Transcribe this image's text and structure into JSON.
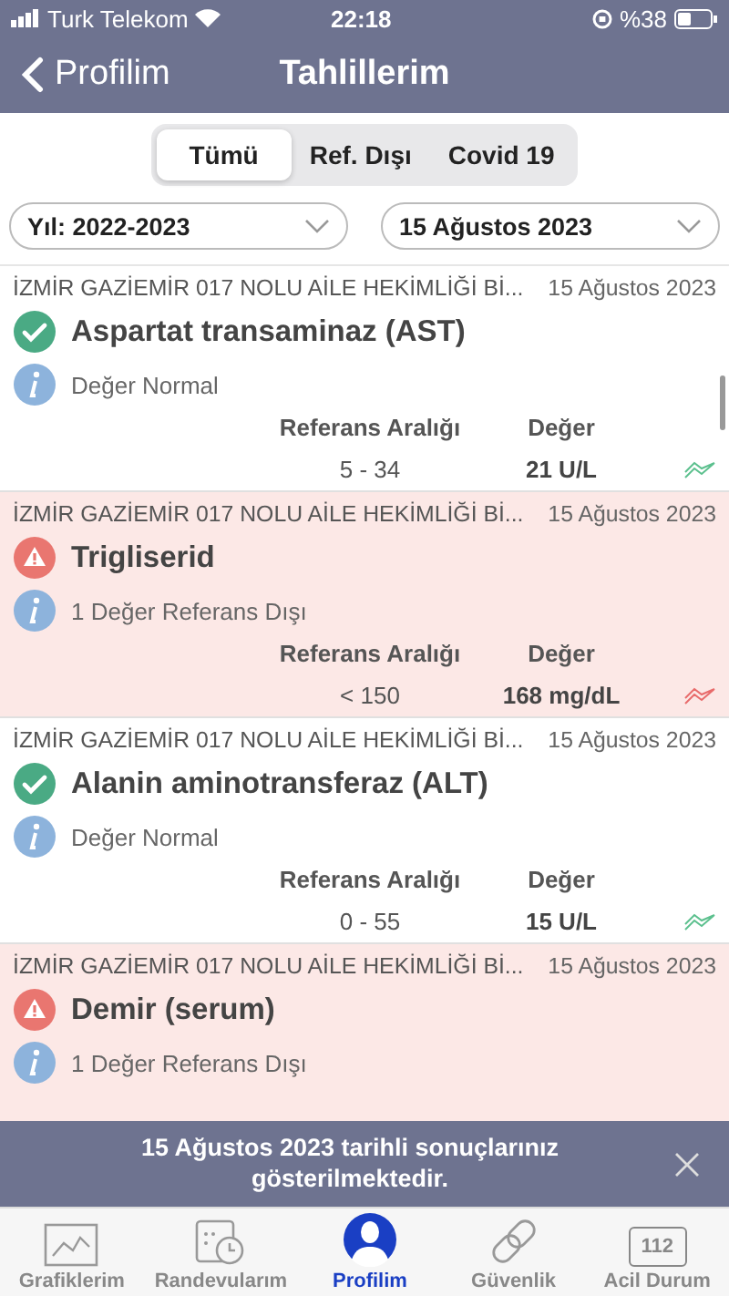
{
  "status_bar": {
    "carrier": "Turk Telekom",
    "time": "22:18",
    "battery": "%38"
  },
  "nav": {
    "back": "Profilim",
    "title": "Tahlillerim"
  },
  "segments": [
    {
      "label": "Tümü",
      "selected": true
    },
    {
      "label": "Ref. Dışı",
      "selected": false
    },
    {
      "label": "Covid 19",
      "selected": false
    }
  ],
  "filters": [
    {
      "value": "Yıl: 2022-2023"
    },
    {
      "value": "15 Ağustos 2023"
    }
  ],
  "results": [
    {
      "kind": "normal",
      "institution": "İZMİR GAZİEMİR 017 NOLU AİLE HEKİMLİĞİ Bİ...",
      "date": "15 Ağustos 2023",
      "test": "Aspartat transaminaz (AST)",
      "note": "Değer Normal",
      "range_label": "Referans Aralığı",
      "value_label": "Değer",
      "range": "5 - 34",
      "value": "21 U/L"
    },
    {
      "kind": "out",
      "institution": "İZMİR GAZİEMİR 017 NOLU AİLE HEKİMLİĞİ Bİ...",
      "date": "15 Ağustos 2023",
      "test": "Trigliserid",
      "note": "1 Değer Referans Dışı",
      "range_label": "Referans Aralığı",
      "value_label": "Değer",
      "range": "< 150",
      "value": "168 mg/dL"
    },
    {
      "kind": "normal",
      "institution": "İZMİR GAZİEMİR 017 NOLU AİLE HEKİMLİĞİ Bİ...",
      "date": "15 Ağustos 2023",
      "test": "Alanin aminotransferaz (ALT)",
      "note": "Değer Normal",
      "range_label": "Referans Aralığı",
      "value_label": "Değer",
      "range": "0 - 55",
      "value": "15 U/L"
    },
    {
      "kind": "out",
      "institution": "İZMİR GAZİEMİR 017 NOLU AİLE HEKİMLİĞİ Bİ...",
      "date": "15 Ağustos 2023",
      "test": "Demir (serum)",
      "note": "1 Değer Referans Dışı"
    }
  ],
  "toast": {
    "message": "15 Ağustos 2023 tarihli sonuçlarınız gösterilmektedir."
  },
  "tab_bar": [
    {
      "kind": "chart",
      "label": "Grafiklerim",
      "selected": false
    },
    {
      "kind": "calendar",
      "label": "Randevularım",
      "selected": false
    },
    {
      "kind": "person",
      "label": "Profilim",
      "selected": true
    },
    {
      "kind": "link",
      "label": "Güvenlik",
      "selected": false
    },
    {
      "kind": "emergency",
      "label": "Acil Durum",
      "selected": false,
      "badge": "112"
    }
  ]
}
